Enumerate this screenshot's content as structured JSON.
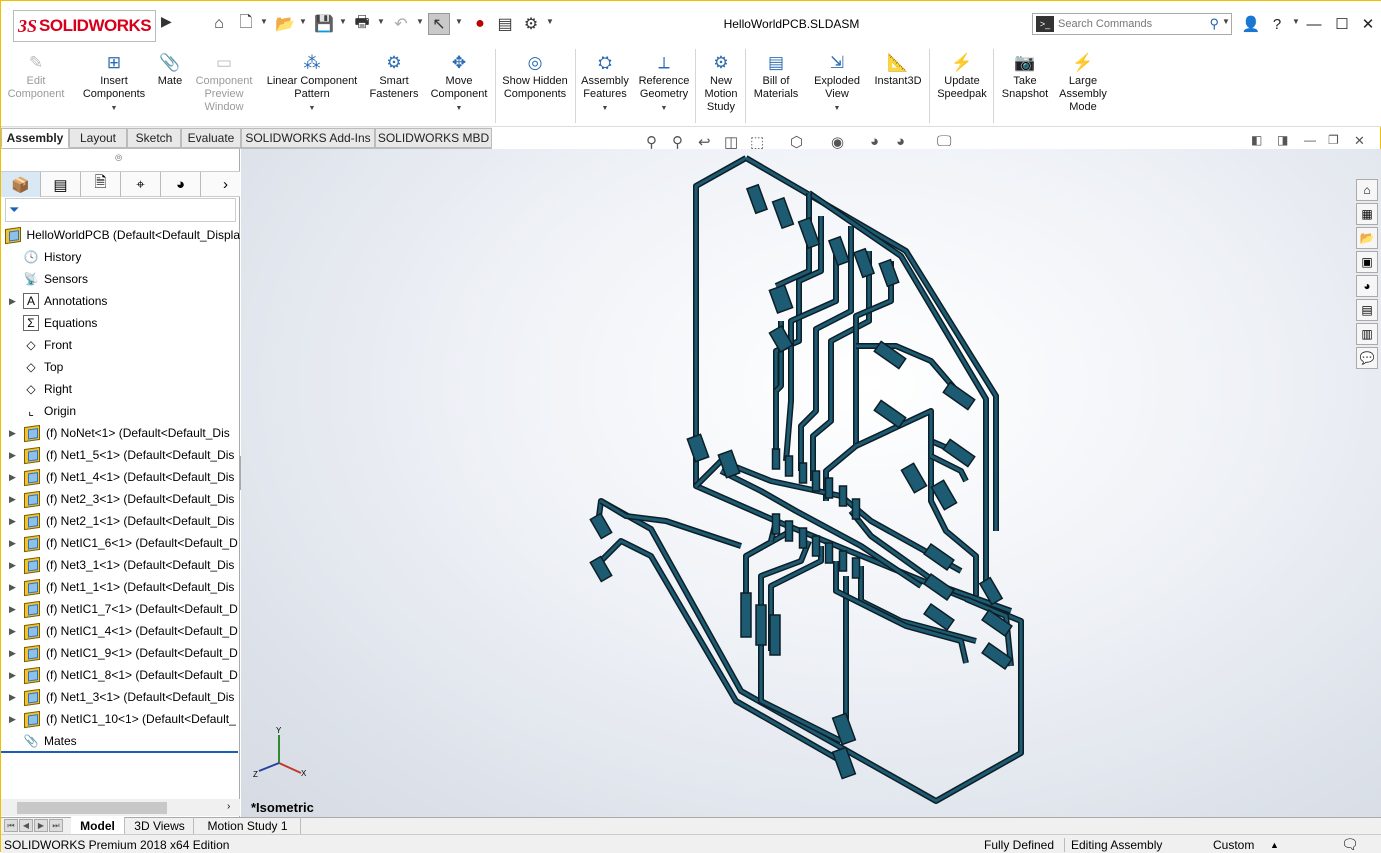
{
  "app": {
    "logo_prefix": "3S",
    "logo_text": "SOLIDWORKS",
    "title": "HelloWorldPCB.SLDASM"
  },
  "search": {
    "placeholder": "Search Commands"
  },
  "ribbon": [
    {
      "label": "Edit Component",
      "disabled": true,
      "icon": "edit-component-icon"
    },
    {
      "label": "Insert Components",
      "icon": "insert-components-icon",
      "dropdown": true
    },
    {
      "label": "Mate",
      "icon": "mate-icon"
    },
    {
      "label": "Component Preview Window",
      "disabled": true,
      "icon": "preview-window-icon"
    },
    {
      "label": "Linear Component Pattern",
      "icon": "pattern-icon",
      "dropdown": true
    },
    {
      "label": "Smart Fasteners",
      "icon": "fastener-icon"
    },
    {
      "label": "Move Component",
      "icon": "move-component-icon",
      "dropdown": true
    },
    {
      "label": "Show Hidden Components",
      "icon": "show-hidden-icon"
    },
    {
      "label": "Assembly Features",
      "icon": "assembly-features-icon",
      "dropdown": true
    },
    {
      "label": "Reference Geometry",
      "icon": "reference-geometry-icon",
      "dropdown": true
    },
    {
      "label": "New Motion Study",
      "icon": "motion-study-icon"
    },
    {
      "label": "Bill of Materials",
      "icon": "bom-icon"
    },
    {
      "label": "Exploded View",
      "icon": "exploded-view-icon",
      "dropdown": true
    },
    {
      "label": "Instant3D",
      "icon": "instant3d-icon"
    },
    {
      "label": "Update Speedpak",
      "icon": "speedpak-icon"
    },
    {
      "label": "Take Snapshot",
      "icon": "snapshot-icon"
    },
    {
      "label": "Large Assembly Mode",
      "icon": "large-assembly-icon"
    }
  ],
  "tabs": [
    "Assembly",
    "Layout",
    "Sketch",
    "Evaluate",
    "SOLIDWORKS Add-Ins",
    "SOLIDWORKS MBD"
  ],
  "tree": {
    "root": "HelloWorldPCB  (Default<Default_Displa",
    "items": [
      {
        "label": "History",
        "icon": "history-icon"
      },
      {
        "label": "Sensors",
        "icon": "sensors-icon"
      },
      {
        "label": "Annotations",
        "icon": "annotations-icon",
        "expand": true
      },
      {
        "label": "Equations",
        "icon": "equations-icon"
      },
      {
        "label": "Front",
        "icon": "plane-icon"
      },
      {
        "label": "Top",
        "icon": "plane-icon"
      },
      {
        "label": "Right",
        "icon": "plane-icon"
      },
      {
        "label": "Origin",
        "icon": "origin-icon"
      },
      {
        "label": "(f) NoNet<1> (Default<Default_Dis",
        "icon": "part-icon",
        "expand": true
      },
      {
        "label": "(f) Net1_5<1> (Default<Default_Dis",
        "icon": "part-icon",
        "expand": true
      },
      {
        "label": "(f) Net1_4<1> (Default<Default_Dis",
        "icon": "part-icon",
        "expand": true
      },
      {
        "label": "(f) Net2_3<1> (Default<Default_Dis",
        "icon": "part-icon",
        "expand": true
      },
      {
        "label": "(f) Net2_1<1> (Default<Default_Dis",
        "icon": "part-icon",
        "expand": true
      },
      {
        "label": "(f) NetIC1_6<1> (Default<Default_D",
        "icon": "part-icon",
        "expand": true
      },
      {
        "label": "(f) Net3_1<1> (Default<Default_Dis",
        "icon": "part-icon",
        "expand": true
      },
      {
        "label": "(f) Net1_1<1> (Default<Default_Dis",
        "icon": "part-icon",
        "expand": true
      },
      {
        "label": "(f) NetIC1_7<1> (Default<Default_D",
        "icon": "part-icon",
        "expand": true
      },
      {
        "label": "(f) NetIC1_4<1> (Default<Default_D",
        "icon": "part-icon",
        "expand": true
      },
      {
        "label": "(f) NetIC1_9<1> (Default<Default_D",
        "icon": "part-icon",
        "expand": true
      },
      {
        "label": "(f) NetIC1_8<1> (Default<Default_D",
        "icon": "part-icon",
        "expand": true
      },
      {
        "label": "(f) Net1_3<1> (Default<Default_Dis",
        "icon": "part-icon",
        "expand": true
      },
      {
        "label": "(f) NetIC1_10<1> (Default<Default_",
        "icon": "part-icon",
        "expand": true
      },
      {
        "label": "Mates",
        "icon": "mates-icon"
      }
    ]
  },
  "viewport": {
    "view_name": "*Isometric",
    "triad": {
      "x": "X",
      "y": "Y",
      "z": "Z"
    },
    "trace_color": "#1d5b73",
    "trace_outline": "#0d1e26"
  },
  "bottom_tabs": [
    "Model",
    "3D Views",
    "Motion Study 1"
  ],
  "status": {
    "edition": "SOLIDWORKS Premium 2018 x64 Edition",
    "state": "Fully Defined",
    "mode": "Editing Assembly",
    "units": "Custom"
  }
}
